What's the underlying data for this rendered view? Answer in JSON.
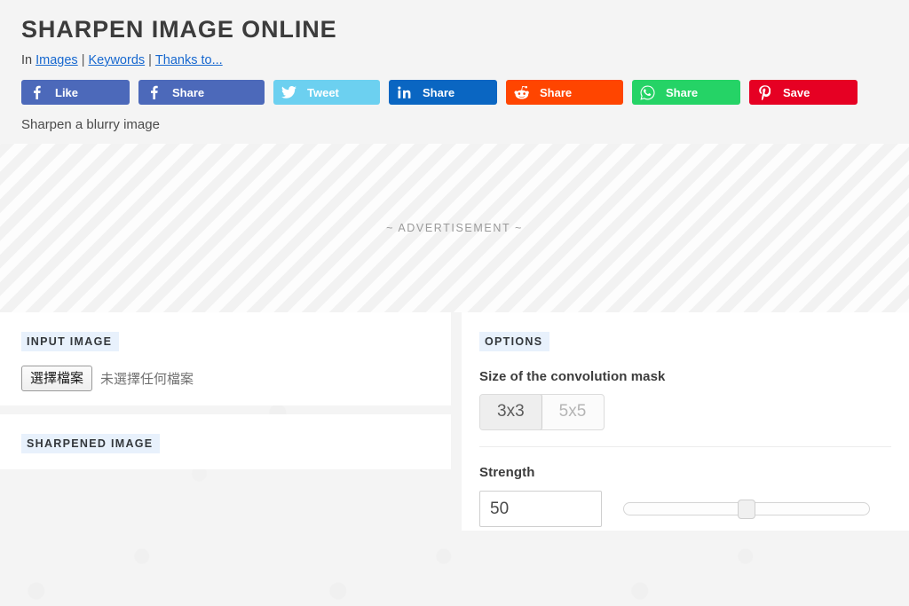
{
  "header": {
    "title": "SHARPEN IMAGE ONLINE",
    "breadcrumb": {
      "prefix": "In",
      "links": [
        "Images",
        "Keywords",
        "Thanks to..."
      ],
      "separator": "|"
    },
    "subtitle": "Sharpen a blurry image",
    "link_color": "#1768cf"
  },
  "social_buttons": [
    {
      "network": "facebook-like",
      "icon": "facebook-f-icon",
      "label": "Like",
      "color": "#4c69ba"
    },
    {
      "network": "facebook-share",
      "icon": "facebook-f-icon",
      "label": "Share",
      "color": "#4c69ba"
    },
    {
      "network": "twitter",
      "icon": "twitter-bird-icon",
      "label": "Tweet",
      "color": "#6cd0f0"
    },
    {
      "network": "linkedin",
      "icon": "linkedin-in-icon",
      "label": "Share",
      "color": "#0a66c2"
    },
    {
      "network": "reddit",
      "icon": "reddit-alien-icon",
      "label": "Share",
      "color": "#ff4500"
    },
    {
      "network": "whatsapp",
      "icon": "whatsapp-icon",
      "label": "Share",
      "color": "#25d366"
    },
    {
      "network": "pinterest",
      "icon": "pinterest-p-icon",
      "label": "Save",
      "color": "#e60023"
    }
  ],
  "advertisement": {
    "label": "~ ADVERTISEMENT ~"
  },
  "panels": {
    "input_image": {
      "title": "INPUT IMAGE",
      "file_button_label": "選擇檔案",
      "file_status": "未選擇任何檔案"
    },
    "sharpened_image": {
      "title": "SHARPENED IMAGE"
    },
    "options": {
      "title": "OPTIONS",
      "mask": {
        "label": "Size of the convolution mask",
        "choices": [
          "3x3",
          "5x5"
        ],
        "selected": "3x3"
      },
      "strength": {
        "label": "Strength",
        "value": "50",
        "slider_percent": 50,
        "min": 0,
        "max": 100
      }
    }
  }
}
